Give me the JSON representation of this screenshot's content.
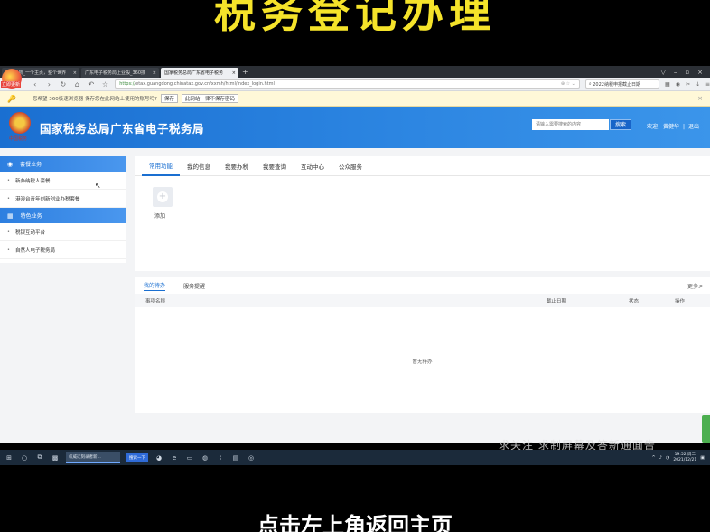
{
  "captions": {
    "top": "税务登记办理",
    "bottom": "点击左上角返回主页",
    "watermark": "求关注  求制屏幕及答新通面告"
  },
  "browser": {
    "logo_label": "立即更新",
    "tabs": [
      {
        "label": "360导航_一个主页，整个世界",
        "active": false
      },
      {
        "label": "广东电子税务局上业般_360搜",
        "active": false
      },
      {
        "label": "国家税务总局广东省电子税务",
        "active": true
      }
    ],
    "new_tab": "+",
    "url_scheme": "https://",
    "url_rest": "etax.guangdong.chinatax.gov.cn/xxmh/html/index_login.html",
    "search_box": "2022纳税申报截止日期",
    "password_bar": {
      "message": "您希望 360极速浏览器 保存您在此网站上使用的账号吗?",
      "save": "保存",
      "never": "此网站一律不保存密码"
    }
  },
  "site": {
    "title": "国家税务总局广东省电子税务局",
    "emblem_text": "中国税务",
    "search_placeholder": "请输入需要搜索的内容",
    "search_button": "搜索",
    "welcome": "欢迎，黄健华",
    "logout": "退出"
  },
  "sidebar": {
    "groups": [
      {
        "label": "套餐业务",
        "items": [
          "新办纳税人套餐",
          "港澳台青年创新创业办税套餐"
        ]
      },
      {
        "label": "特色业务",
        "items": [
          "税银互动平台",
          "自然人电子税务局"
        ]
      }
    ]
  },
  "main": {
    "tabs": [
      "常用功能",
      "我的信息",
      "我要办税",
      "我要查询",
      "互动中心",
      "公众服务"
    ],
    "active_tab": 0,
    "add_label": "添加",
    "todo": {
      "tabs": [
        "我的待办",
        "服务提醒"
      ],
      "more": "更多>",
      "columns": [
        "事项名称",
        "截止日期",
        "状态",
        "操作"
      ],
      "empty": "暂无待办"
    }
  },
  "taskbar": {
    "window_label": "权威迁刻录者新...",
    "blue_label": "搜索一下",
    "time": "19:52 周二",
    "date": "2021/12/21"
  }
}
